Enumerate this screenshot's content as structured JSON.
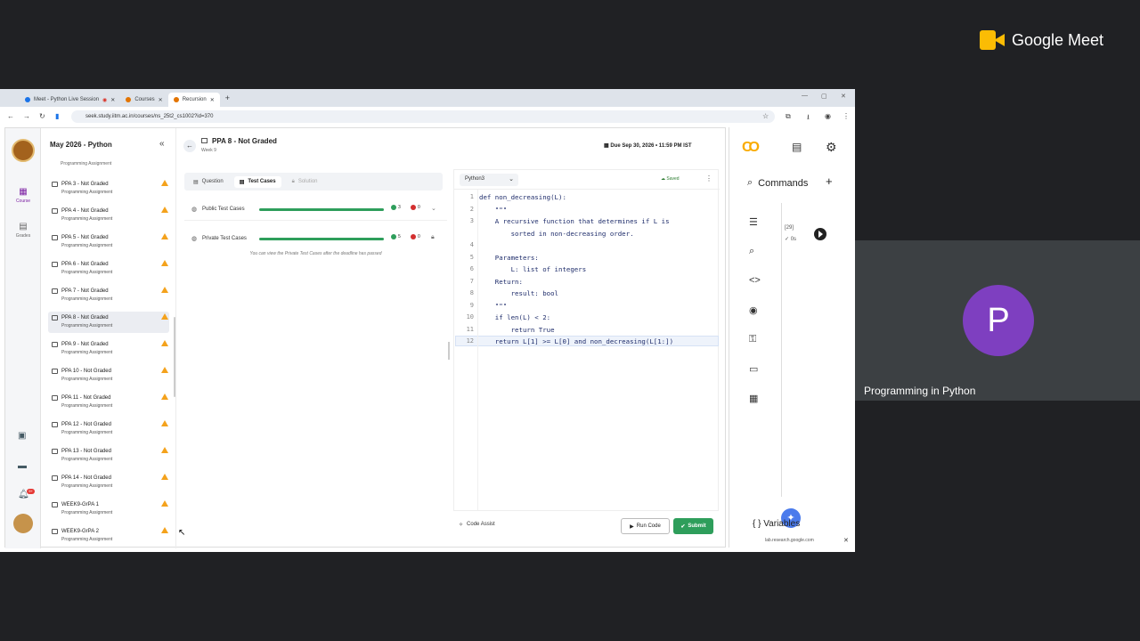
{
  "meet": {
    "brand": "Google Meet",
    "participant_initial": "P",
    "participant_name": "Programming in Python"
  },
  "browser": {
    "tabs": [
      {
        "label": "Meet - Python Live Session",
        "color": "#1a73e8",
        "active": false
      },
      {
        "label": "Courses",
        "color": "#e37400",
        "active": false
      },
      {
        "label": "Recursion",
        "color": "#e37400",
        "active": true
      }
    ],
    "url": "seek.study.iitm.ac.in/courses/ns_25t2_cs1002?id=370"
  },
  "rail": {
    "course_label": "Course",
    "grades_label": "Grades",
    "notif_count": "9+"
  },
  "sidebar": {
    "course_title": "May 2026 - Python",
    "top_partial_sub": "Programming Assignment",
    "items": [
      {
        "title": "PPA 3 - Not Graded",
        "sub": "Programming Assignment"
      },
      {
        "title": "PPA 4 - Not Graded",
        "sub": "Programming Assignment"
      },
      {
        "title": "PPA 5 - Not Graded",
        "sub": "Programming Assignment"
      },
      {
        "title": "PPA 6 - Not Graded",
        "sub": "Programming Assignment"
      },
      {
        "title": "PPA 7 - Not Graded",
        "sub": "Programming Assignment"
      },
      {
        "title": "PPA 8 - Not Graded",
        "sub": "Programming Assignment"
      },
      {
        "title": "PPA 9 - Not Graded",
        "sub": "Programming Assignment"
      },
      {
        "title": "PPA 10 - Not Graded",
        "sub": "Programming Assignment"
      },
      {
        "title": "PPA 11 - Not Graded",
        "sub": "Programming Assignment"
      },
      {
        "title": "PPA 12 - Not Graded",
        "sub": "Programming Assignment"
      },
      {
        "title": "PPA 13 - Not Graded",
        "sub": "Programming Assignment"
      },
      {
        "title": "PPA 14 - Not Graded",
        "sub": "Programming Assignment"
      },
      {
        "title": "WEEK9-GrPA 1",
        "sub": "Programming Assignment"
      },
      {
        "title": "WEEK9-GrPA 2",
        "sub": "Programming Assignment"
      }
    ]
  },
  "header": {
    "title": "PPA 8 - Not Graded",
    "week": "Week 9",
    "due": "Due Sep 30, 2026 • 11:59 PM IST"
  },
  "qtabs": {
    "question": "Question",
    "test_cases": "Test Cases",
    "solution": "Solution"
  },
  "test_cases": {
    "public_label": "Public Test Cases",
    "public_pass": "3",
    "public_fail": "0",
    "private_label": "Private Test Cases",
    "private_pass": "5",
    "private_fail": "0",
    "private_note": "You can view the Private Test Cases after the deadline has passed"
  },
  "editor": {
    "language": "Python3",
    "saved": "Saved",
    "lines": [
      {
        "n": "1",
        "code": "def non_decreasing(L):"
      },
      {
        "n": "2",
        "code": "    \"\"\""
      },
      {
        "n": "3",
        "code": "    A recursive function that determines if L is"
      },
      {
        "n": "",
        "code": "        sorted in non-decreasing order."
      },
      {
        "n": "4",
        "code": ""
      },
      {
        "n": "5",
        "code": "    Parameters:"
      },
      {
        "n": "6",
        "code": "        L: list of integers"
      },
      {
        "n": "7",
        "code": "    Return:"
      },
      {
        "n": "8",
        "code": "        result: bool"
      },
      {
        "n": "9",
        "code": "    \"\"\""
      },
      {
        "n": "10",
        "code": "    if len(L) < 2:"
      },
      {
        "n": "11",
        "code": "        return True"
      },
      {
        "n": "12",
        "code": "    return L[1] >= L[0] and non_decreasing(L[1:])"
      }
    ],
    "code_assist": "Code Assist",
    "run": "Run Code",
    "submit": "Submit"
  },
  "colab": {
    "commands": "Commands",
    "cell_number": "[29]",
    "cell_status": "✓ 0s",
    "variables": "Variables",
    "status_url": "lab.research.google.com"
  }
}
